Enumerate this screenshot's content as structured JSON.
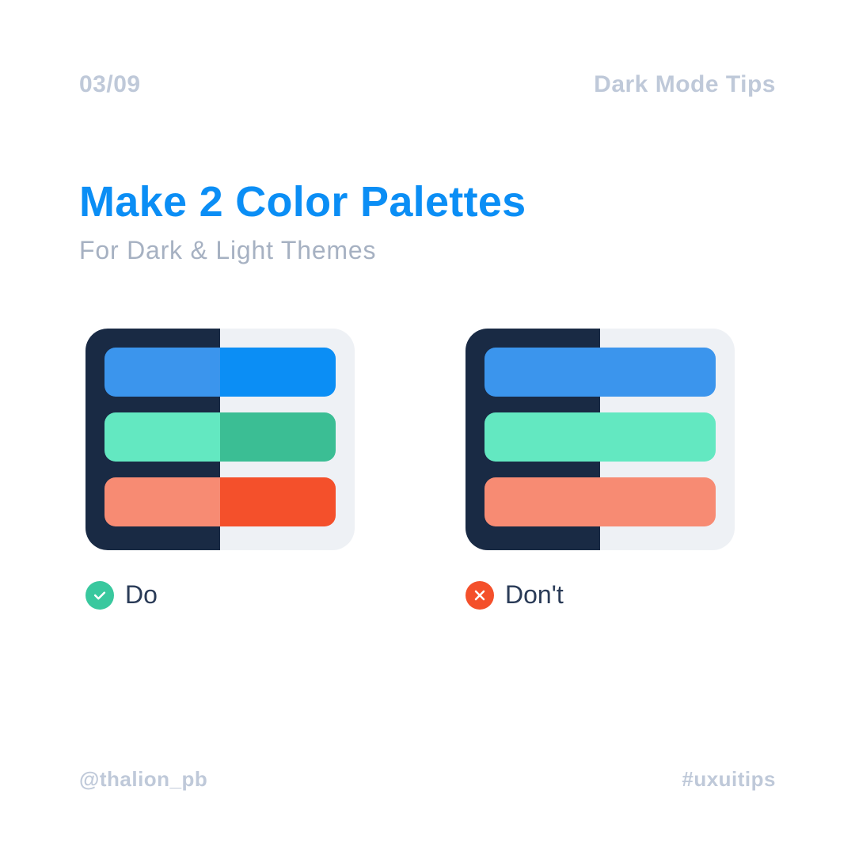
{
  "header": {
    "page_num": "03/09",
    "category": "Dark Mode Tips"
  },
  "title": "Make 2 Color Palettes",
  "subtitle": "For Dark & Light Themes",
  "examples": {
    "do": {
      "label": "Do",
      "icon_bg": "#39c89e",
      "card_dark_bg": "#192a44",
      "card_light_bg": "#eef1f5",
      "bars": [
        {
          "dark": "#3b95ed",
          "light": "#0b8ef5"
        },
        {
          "dark": "#63e8c1",
          "light": "#3bbe94"
        },
        {
          "dark": "#f78b73",
          "light": "#f4502b"
        }
      ]
    },
    "dont": {
      "label": "Don't",
      "icon_bg": "#f4502b",
      "card_dark_bg": "#192a44",
      "card_light_bg": "#eef1f5",
      "bars": [
        {
          "dark": "#3b95ed",
          "light": "#3b95ed"
        },
        {
          "dark": "#63e8c1",
          "light": "#63e8c1"
        },
        {
          "dark": "#f78b73",
          "light": "#f78b73"
        }
      ]
    }
  },
  "footer": {
    "handle": "@thalion_pb",
    "hashtag": "#uxuitips"
  }
}
